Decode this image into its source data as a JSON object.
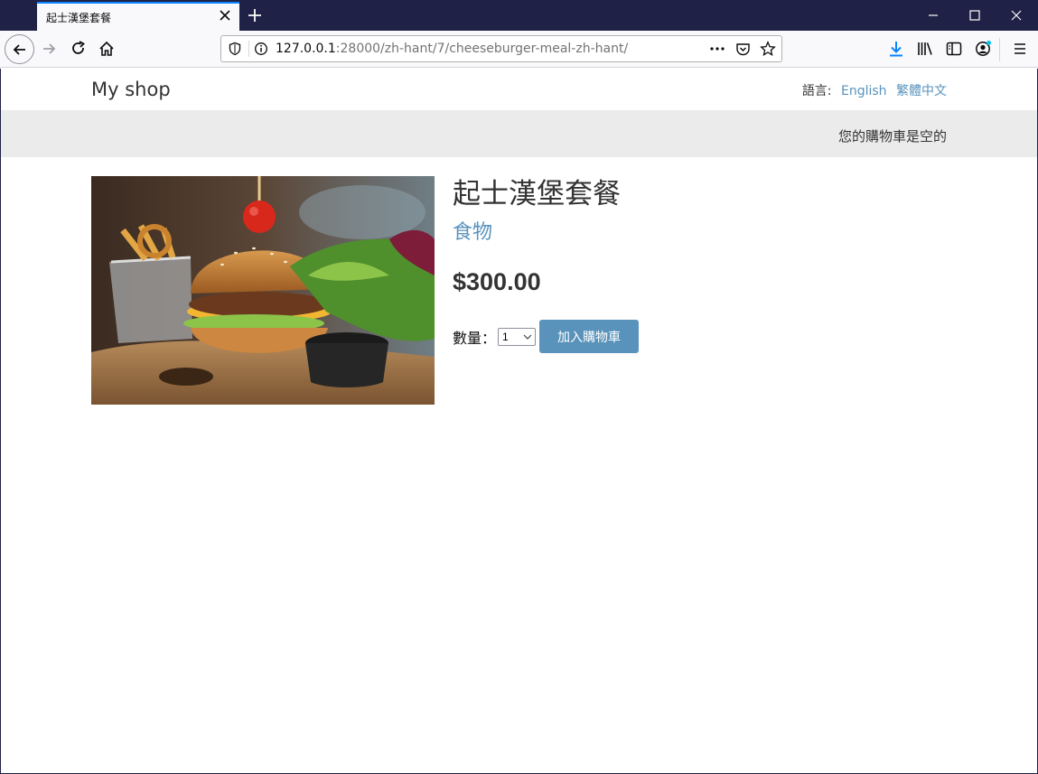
{
  "browser": {
    "tab_title": "起士漢堡套餐",
    "url_host": "127.0.0.1",
    "url_rest": ":28000/zh-hant/7/cheeseburger-meal-zh-hant/"
  },
  "header": {
    "brand": "My shop",
    "language_label": "語言:",
    "languages": [
      {
        "label": "English"
      },
      {
        "label": "繁體中文"
      }
    ]
  },
  "cart": {
    "status": "您的購物車是空的"
  },
  "product": {
    "name": "起士漢堡套餐",
    "category": "食物",
    "price": "$300.00",
    "quantity_label": "數量：",
    "quantity_value": "1",
    "add_button": "加入購物車",
    "image_icon": "cheeseburger-photo"
  },
  "colors": {
    "accent": "#5993bb",
    "titlebar": "#1f2146",
    "cartbar": "#ebebeb"
  }
}
